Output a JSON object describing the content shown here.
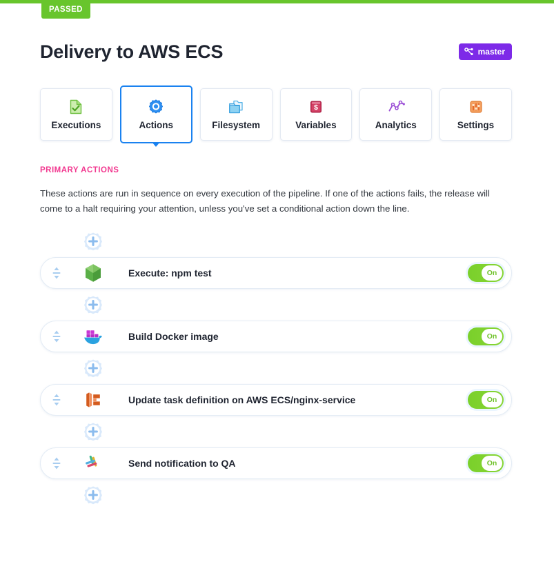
{
  "status": {
    "badge_label": "PASSED",
    "bar_color": "#68c52c"
  },
  "header": {
    "title": "Delivery to AWS ECS",
    "branch_badge": {
      "label": "master",
      "icon": "git-branch-icon",
      "color": "#7d2ae8"
    }
  },
  "tabs": [
    {
      "label": "Executions",
      "icon": "document-check-icon",
      "selected": false
    },
    {
      "label": "Actions",
      "icon": "gear-icon",
      "selected": true
    },
    {
      "label": "Filesystem",
      "icon": "folders-icon",
      "selected": false
    },
    {
      "label": "Variables",
      "icon": "dollar-box-icon",
      "selected": false
    },
    {
      "label": "Analytics",
      "icon": "line-chart-icon",
      "selected": false
    },
    {
      "label": "Settings",
      "icon": "sliders-icon",
      "selected": false
    }
  ],
  "section": {
    "heading": "PRIMARY ACTIONS",
    "heading_color": "#f2378f",
    "description": "These actions are run in sequence on every execution of the pipeline. If one of the actions fails, the release will come to a halt requiring your attention, unless you've set a conditional action down the line."
  },
  "actions": [
    {
      "label": "Execute: npm test",
      "icon": "nodejs-hexagon-icon",
      "toggle_label": "On",
      "toggle_on": true
    },
    {
      "label": "Build Docker image",
      "icon": "docker-whale-icon",
      "toggle_label": "On",
      "toggle_on": true
    },
    {
      "label": "Update task definition on AWS ECS/nginx-service",
      "icon": "aws-ecs-icon",
      "toggle_label": "On",
      "toggle_on": true
    },
    {
      "label": "Send notification to QA",
      "icon": "slack-icon",
      "toggle_label": "On",
      "toggle_on": true
    }
  ],
  "add_buttons": {
    "icon": "gear-plus-icon",
    "count": 5
  }
}
